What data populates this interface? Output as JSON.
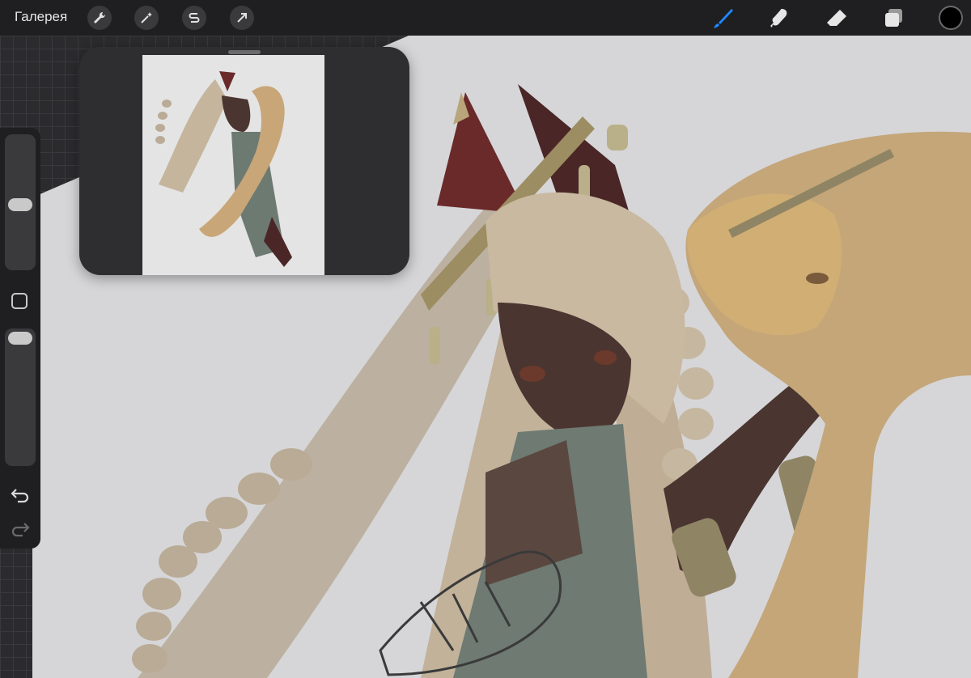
{
  "toolbar": {
    "gallery_label": "Галерея",
    "left_tools": [
      "wrench-icon",
      "magic-wand-icon",
      "selection-s-icon",
      "transform-arrow-icon"
    ],
    "right_tools": [
      "brush-icon",
      "smudge-icon",
      "eraser-icon",
      "layers-icon"
    ],
    "active_tool": "brush",
    "accent_color": "#1e88ff",
    "current_color": "#000000"
  },
  "sidebar": {
    "brush_size": 0.48,
    "opacity": 1.0,
    "icons": [
      "modify-square-icon",
      "undo-icon",
      "redo-icon"
    ]
  },
  "reference": {
    "thumbnail_bg": "#e6e6e6"
  },
  "canvas": {
    "background": "#d8d8d9"
  }
}
